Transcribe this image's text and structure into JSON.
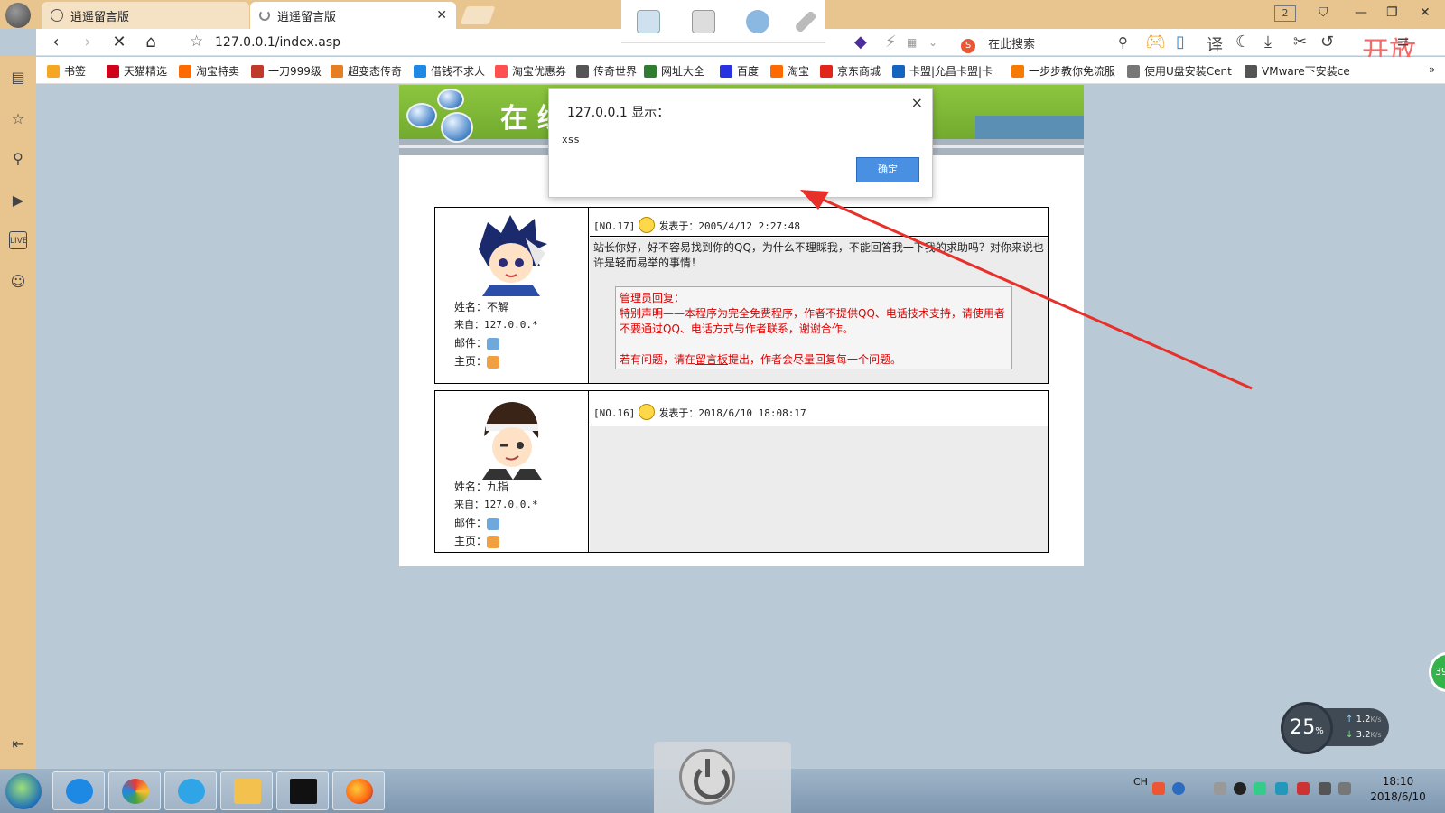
{
  "browser": {
    "tabs": [
      {
        "label": "逍遥留言版"
      },
      {
        "label": "逍遥留言版"
      }
    ],
    "tab_count": "2",
    "url": "127.0.0.1/index.asp",
    "search_placeholder": "在此搜索",
    "translate_label": "译",
    "brand_overlay": "开放",
    "bookmarks": [
      {
        "label": "书签",
        "color": "#f5a623"
      },
      {
        "label": "天猫精选",
        "color": "#d0021b"
      },
      {
        "label": "淘宝特卖",
        "color": "#ff6a00"
      },
      {
        "label": "一刀999级",
        "color": "#c0392b"
      },
      {
        "label": "超变态传奇",
        "color": "#e67e22"
      },
      {
        "label": "借钱不求人",
        "color": "#1e88e5"
      },
      {
        "label": "淘宝优惠券",
        "color": "#ff4f4f"
      },
      {
        "label": "传奇世界",
        "color": "#555555"
      },
      {
        "label": "网址大全",
        "color": "#2e7d32"
      },
      {
        "label": "百度",
        "color": "#2932e1"
      },
      {
        "label": "淘宝",
        "color": "#ff6a00"
      },
      {
        "label": "京东商城",
        "color": "#e1251b"
      },
      {
        "label": "卡盟|允昌卡盟|卡",
        "color": "#1565c0"
      },
      {
        "label": "一步步教你免流服",
        "color": "#f57c00"
      },
      {
        "label": "使用U盘安装Cent",
        "color": "#777777"
      },
      {
        "label": "VMware下安装ce",
        "color": "#555555"
      }
    ]
  },
  "dialog": {
    "title": "127.0.0.1 显示：",
    "message": "xss",
    "ok_label": "确定",
    "close_label": "×"
  },
  "page": {
    "banner_title": "在 线",
    "posts": [
      {
        "number": "[NO.17]",
        "posted": "发表于：2005/4/12 2:27:48",
        "name_label": "姓名：",
        "name": "不解",
        "from_label": "来自：",
        "from": "127.0.0.*",
        "email_label": "邮件：",
        "home_label": "主页：",
        "content": "站长你好，好不容易找到你的QQ，为什么不理睬我，不能回答我一下我的求助吗？对你来说也许是轻而易举的事情！",
        "admin_reply_title": "管理员回复：",
        "admin_reply_line1": "特别声明——本程序为完全免费程序，作者不提供QQ、电话技术支持，请使用者不要通过QQ、电话方式与作者联系，谢谢合作。",
        "admin_reply_line2_pre": "若有问题，请在",
        "admin_reply_link": "留言板",
        "admin_reply_line2_post": "提出，作者会尽量回复每一个问题。"
      },
      {
        "number": "[NO.16]",
        "posted": "发表于：2018/6/10 18:08:17",
        "name_label": "姓名：",
        "name": "九指",
        "from_label": "来自：",
        "from": "127.0.0.*",
        "email_label": "邮件：",
        "home_label": "主页：",
        "content": ""
      }
    ]
  },
  "net_widget": {
    "percent": "25",
    "percent_unit": "%",
    "up": "1.2",
    "down": "3.2",
    "speed_unit": "K/s"
  },
  "green_badge": "39",
  "taskbar": {
    "tray_lang": "CH",
    "time": "18:10",
    "date": "2018/6/10"
  },
  "colors": {
    "chrome": "#e8c48e",
    "banner_green": "#8cc63f",
    "admin_red": "#e00000",
    "ok_blue": "#4a90e2",
    "arrow_red": "#e8302a"
  }
}
